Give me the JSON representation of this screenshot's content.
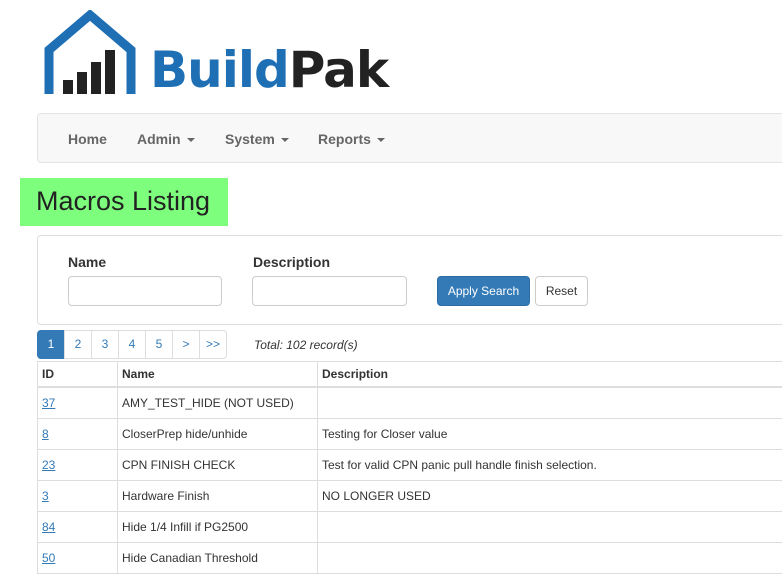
{
  "brand": {
    "part1": "Build",
    "part2": "Pak"
  },
  "nav": [
    {
      "label": "Home",
      "dropdown": false
    },
    {
      "label": "Admin",
      "dropdown": true
    },
    {
      "label": "System",
      "dropdown": true
    },
    {
      "label": "Reports",
      "dropdown": true
    }
  ],
  "page_title": "Macros Listing",
  "filters": {
    "name_label": "Name",
    "name_value": "",
    "description_label": "Description",
    "description_value": "",
    "apply_label": "Apply Search",
    "reset_label": "Reset"
  },
  "pagination": {
    "pages": [
      "1",
      "2",
      "3",
      "4",
      "5",
      ">",
      ">>"
    ],
    "active": "1",
    "total_text": "Total: 102 record(s)"
  },
  "table": {
    "headers": [
      "ID",
      "Name",
      "Description"
    ],
    "rows": [
      {
        "id": "37",
        "name": "AMY_TEST_HIDE (NOT USED)",
        "description": ""
      },
      {
        "id": "8",
        "name": "CloserPrep hide/unhide",
        "description": "Testing for Closer value"
      },
      {
        "id": "23",
        "name": "CPN FINISH CHECK",
        "description": "Test for valid CPN panic pull handle finish selection."
      },
      {
        "id": "3",
        "name": "Hardware Finish",
        "description": "NO LONGER USED"
      },
      {
        "id": "84",
        "name": "Hide 1/4 Infill if PG2500",
        "description": ""
      },
      {
        "id": "50",
        "name": "Hide Canadian Threshold",
        "description": ""
      }
    ]
  },
  "colors": {
    "brand_blue": "#1f6fb5",
    "primary": "#337ab7",
    "title_highlight": "#7dff7d"
  }
}
